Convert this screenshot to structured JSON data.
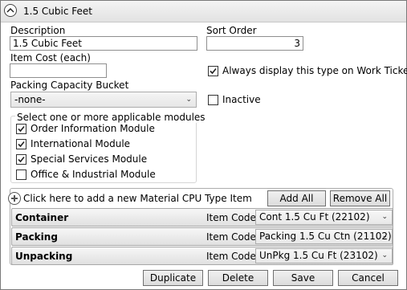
{
  "header": {
    "title": "1.5 Cubic Feet"
  },
  "form": {
    "description_label": "Description",
    "description_value": "1.5 Cubic Feet",
    "sort_order_label": "Sort Order",
    "sort_order_value": "3",
    "item_cost_label": "Item Cost (each)",
    "item_cost_value": "",
    "always_display_label": "Always display this type on Work Tickets",
    "always_display_checked": true,
    "packing_bucket_label": "Packing Capacity Bucket",
    "packing_bucket_value": "-none-",
    "inactive_label": "Inactive",
    "inactive_checked": false
  },
  "modules": {
    "legend": "Select one or more applicable modules",
    "items": [
      {
        "label": "Order Information Module",
        "checked": true
      },
      {
        "label": "International Module",
        "checked": true
      },
      {
        "label": "Special Services Module",
        "checked": true
      },
      {
        "label": "Office & Industrial Module",
        "checked": false
      }
    ]
  },
  "material": {
    "add_prompt": "Click here to add a new Material CPU Type Item",
    "add_all_label": "Add All",
    "remove_all_label": "Remove All",
    "item_code_label": "Item Code:",
    "rows": [
      {
        "name": "Container",
        "code": "Cont 1.5 Cu Ft (22102)"
      },
      {
        "name": "Packing",
        "code": "Packing 1.5 Cu Ctn (21102)"
      },
      {
        "name": "Unpacking",
        "code": "UnPkg 1.5 Cu Ft (23102)"
      }
    ]
  },
  "footer": {
    "duplicate_label": "Duplicate",
    "delete_label": "Delete",
    "save_label": "Save",
    "cancel_label": "Cancel"
  }
}
